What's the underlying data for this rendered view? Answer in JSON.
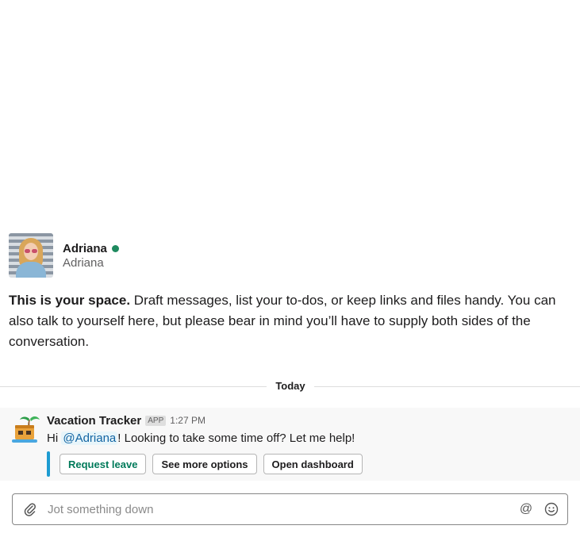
{
  "profile": {
    "display_name": "Adriana",
    "real_name": "Adriana",
    "status": "online"
  },
  "intro": {
    "bold": "This is your space.",
    "text": " Draft messages, list your to-dos, or keep links and files handy. You can also talk to yourself here, but please bear in mind you’ll have to supply both sides of the conversation."
  },
  "divider": {
    "label": "Today"
  },
  "message": {
    "sender": "Vacation Tracker",
    "badge": "APP",
    "time": "1:27 PM",
    "text_prefix": "Hi ",
    "mention": "@Adriana",
    "text_suffix": "! Looking to take some time off? Let me help!",
    "buttons": [
      "Request leave",
      "See more options",
      "Open dashboard"
    ]
  },
  "composer": {
    "placeholder": "Jot something down",
    "attach_icon": "paperclip-icon",
    "mention_icon": "at-icon",
    "emoji_icon": "smiley-icon"
  },
  "colors": {
    "presence": "#1f8a5f",
    "accent_bar": "#1d9bd1",
    "mention": "#1264a3",
    "primary_button_text": "#007a5a"
  }
}
